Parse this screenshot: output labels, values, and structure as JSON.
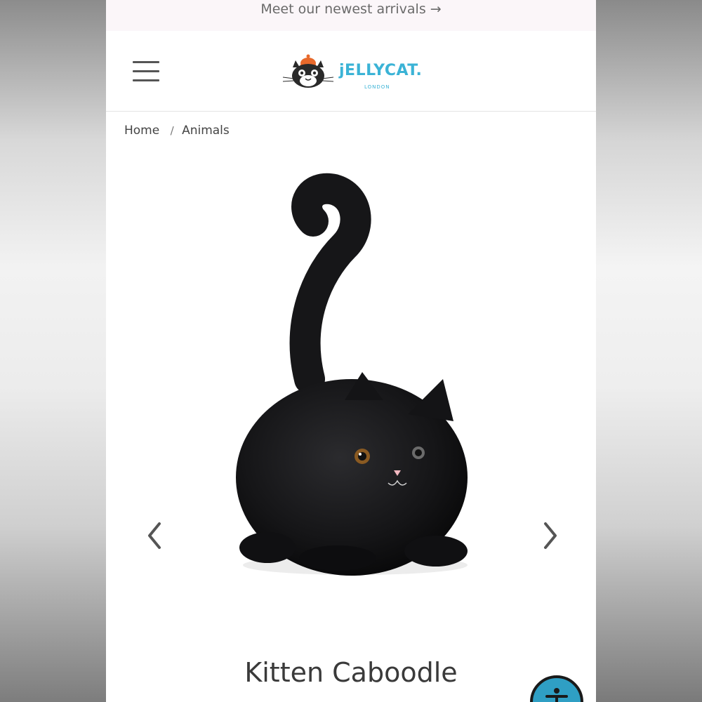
{
  "announcement": {
    "text": "Meet our newest arrivals →"
  },
  "header": {
    "logo_text": "jELLYCAT.",
    "logo_sub": "LONDON"
  },
  "breadcrumb": {
    "home": "Home",
    "separator": "/",
    "current": "Animals"
  },
  "product": {
    "title": "Kitten Caboodle"
  },
  "icons": {
    "menu": "hamburger-menu-icon",
    "prev": "chevron-left-icon",
    "next": "chevron-right-icon",
    "accessibility": "accessibility-icon"
  },
  "colors": {
    "brand": "#3bb3d6",
    "announcement_bg": "#fbf6f9",
    "accessibility_bg": "#2f9fc4"
  }
}
